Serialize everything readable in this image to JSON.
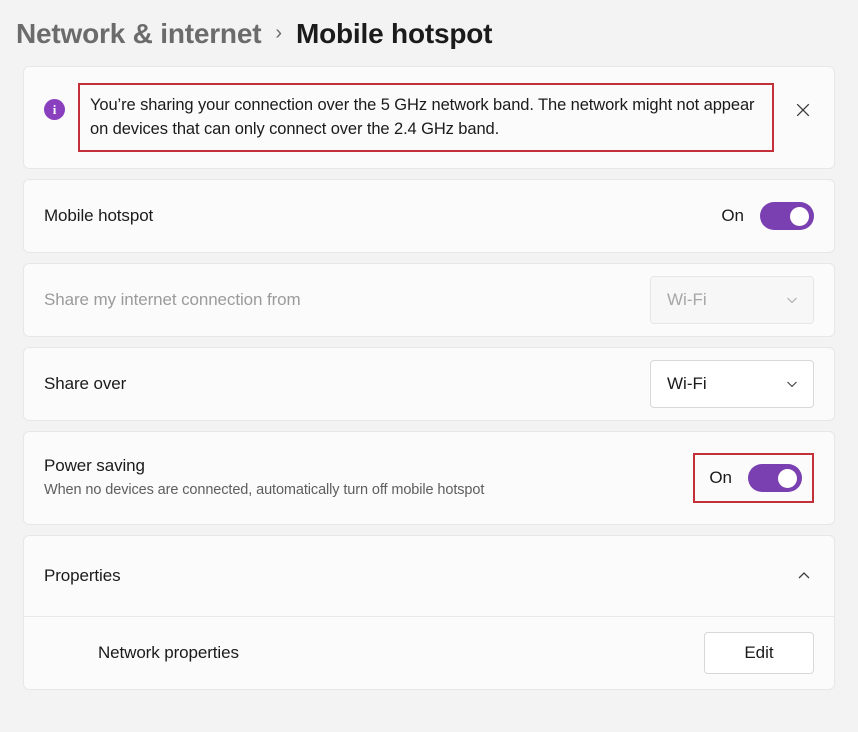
{
  "breadcrumb": {
    "parent": "Network & internet",
    "separator": "›",
    "current": "Mobile hotspot"
  },
  "banner": {
    "icon": "info-icon",
    "icon_glyph": "i",
    "message": "You’re sharing your connection over the 5 GHz network band. The network might not appear on devices that can only connect over the 2.4 GHz band.",
    "close_icon": "close-icon",
    "highlight_color": "#c4303a",
    "icon_color": "#8a3fbe"
  },
  "settings": {
    "mobile_hotspot": {
      "title": "Mobile hotspot",
      "toggle_state": "On",
      "toggle_color": "#7a3fb0"
    },
    "share_from": {
      "title": "Share my internet connection from",
      "value": "Wi-Fi",
      "disabled": true
    },
    "share_over": {
      "title": "Share over",
      "value": "Wi-Fi",
      "disabled": false
    },
    "power_saving": {
      "title": "Power saving",
      "description": "When no devices are connected, automatically turn off mobile hotspot",
      "toggle_state": "On",
      "highlighted": true
    }
  },
  "properties": {
    "title": "Properties",
    "expanded": true,
    "chevron_icon": "chevron-up-icon",
    "items": [
      {
        "label": "Network properties",
        "action": "Edit"
      }
    ]
  }
}
